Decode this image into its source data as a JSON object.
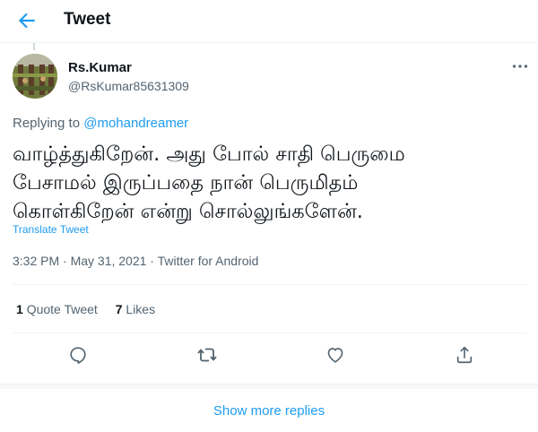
{
  "header": {
    "title": "Tweet",
    "back_icon": "arrow-left-icon"
  },
  "tweet": {
    "author_name": "Rs.Kumar",
    "author_handle": "@RsKumar85631309",
    "replying_prefix": "Replying to",
    "replying_to": "@mohandreamer",
    "text_lines": [
      "வாழ்த்துகிறேன். அது போல் சாதி பெருமை",
      "பேசாமல் இருப்பதை நான் பெருமிதம்",
      "கொள்கிறேன் என்று சொல்லுங்களேன்."
    ],
    "translate_label": "Translate Tweet",
    "timestamp": "3:32 PM · May 31, 2021 · Twitter for Android"
  },
  "stats": {
    "quote_count": "1",
    "quote_label": "Quote Tweet",
    "likes_count": "7",
    "likes_label": "Likes"
  },
  "actions": [
    "reply-icon",
    "retweet-icon",
    "like-icon",
    "share-icon"
  ],
  "footer": {
    "show_more": "Show more replies"
  },
  "colors": {
    "accent": "#1d9bf0",
    "text": "#0f1419",
    "muted": "#536471",
    "border": "#eff3f4"
  }
}
